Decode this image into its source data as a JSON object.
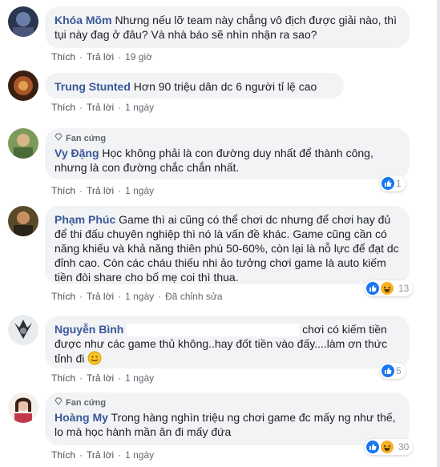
{
  "colors": {
    "name": "#385898",
    "like": "#1877f2",
    "haha": "#f7b125"
  },
  "actions": {
    "like": "Thích",
    "reply": "Trả lời",
    "edited": "Đã chỉnh sửa"
  },
  "fan_badge": "Fan cứng",
  "comments": [
    {
      "name": "Khóa Mõm",
      "text": "Nhưng nếu lỡ team này chẳng vô địch được giải nào, thì tụi này đag ở đâu? Và nhà báo sẽ nhìn nhận ra sao?",
      "time": "19 giờ"
    },
    {
      "name": "Trung Stunted",
      "text": "Hơn 90 triệu dân dc 6 người tỉ lệ cao",
      "time": "1 ngày"
    },
    {
      "name": "Vy Đặng",
      "text": "Học không phải là con đường duy nhất để thành công, nhưng là con đường chắc chắn nhất.",
      "time": "1 ngày",
      "reactions": "1"
    },
    {
      "name": "Phạm Phúc",
      "text": "Game thì ai cũng có thể chơi dc nhưng để chơi hay đủ để thi đấu chuyên nghiệp thì nó là vấn đề khác. Game cũng cần có năng khiếu và khả năng thiên phú 50-60%, còn lại là nỗ lực để đạt dc đỉnh cao. Còn các cháu thiếu nhi ảo tưởng chơi game là auto kiếm tiền đòi share cho bố mẹ coi thì thua.",
      "time": "1 ngày",
      "reactions": "13"
    },
    {
      "name": "Nguyễn Bình",
      "text_end": "chơi có kiếm tiền",
      "text_rest": "được như các game thủ không..hay đốt tiền vào đấy....làm ơn thức tỉnh đi",
      "time": "1 ngày",
      "reactions": "5"
    },
    {
      "name": "Hoàng My",
      "text": "Trong hàng nghìn triệu ng chơi game đc mấy ng như thế, lo mà học hành mần ăn đi mấy đứa",
      "time": "1 ngày",
      "reactions": "30"
    }
  ]
}
